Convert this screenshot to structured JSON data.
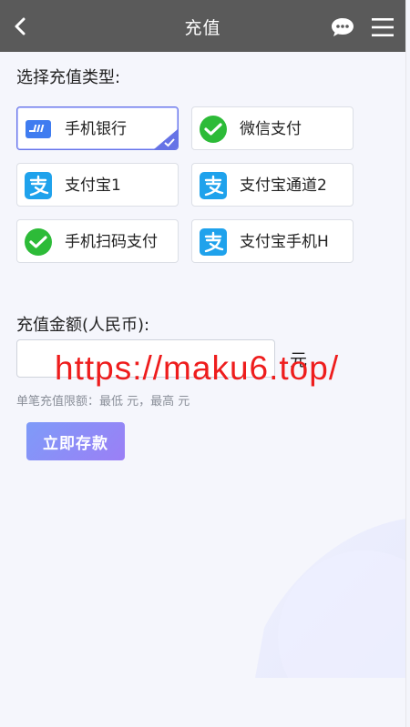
{
  "header": {
    "title": "充值"
  },
  "labels": {
    "select_type": "选择充值类型:",
    "amount": "充值金额(人民币):",
    "unit": "元",
    "limit": "单笔充值限额：最低 元，最高 元"
  },
  "payment_methods": [
    {
      "label": "手机银行",
      "icon": "bank-card-icon",
      "selected": true
    },
    {
      "label": "微信支付",
      "icon": "wechat-icon",
      "selected": false
    },
    {
      "label": "支付宝1",
      "icon": "alipay-icon",
      "selected": false
    },
    {
      "label": "支付宝通道2",
      "icon": "alipay-icon",
      "selected": false
    },
    {
      "label": "手机扫码支付",
      "icon": "wechat-icon",
      "selected": false
    },
    {
      "label": "支付宝手机H",
      "icon": "alipay-icon",
      "selected": false
    }
  ],
  "amount_input": {
    "value": "",
    "placeholder": ""
  },
  "submit": {
    "label": "立即存款"
  },
  "watermark": "https://maku6.top/",
  "colors": {
    "header": "#5a5a5a",
    "selected_border": "#6673e6",
    "wechat": "#2dbb38",
    "alipay": "#1fa2ec",
    "bank": "#3f7cf0",
    "watermark": "#ee1d1d"
  }
}
